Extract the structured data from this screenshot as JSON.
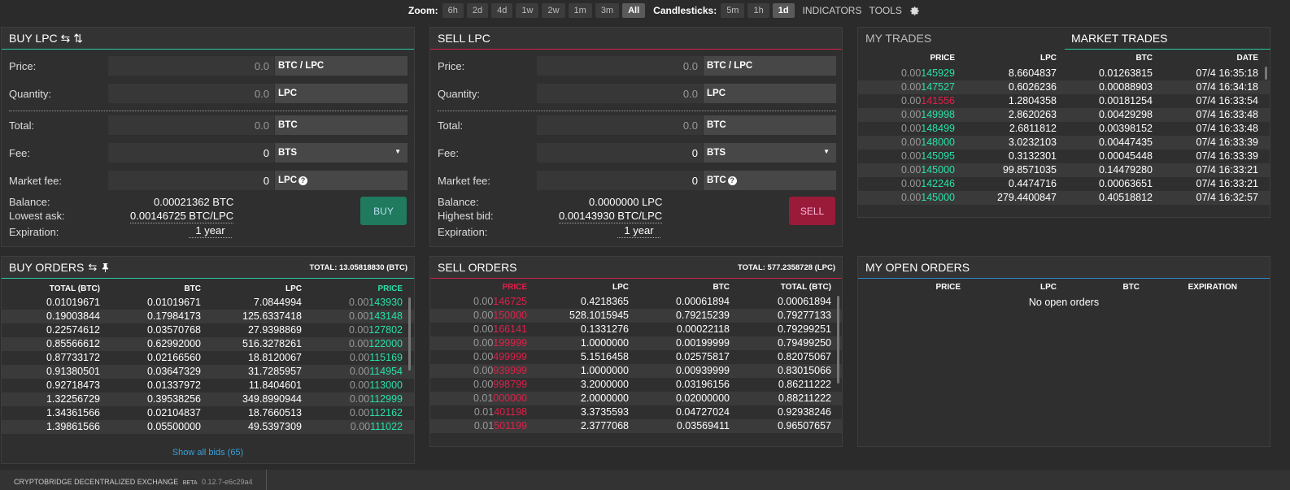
{
  "toolbar": {
    "zoom_label": "Zoom:",
    "zoom": [
      "6h",
      "2d",
      "4d",
      "1w",
      "2w",
      "1m",
      "3m",
      "All"
    ],
    "zoom_active": "All",
    "candle_label": "Candlesticks:",
    "candles": [
      "5m",
      "1h",
      "1d"
    ],
    "candle_active": "1d",
    "indicators": "INDICATORS",
    "tools": "TOOLS"
  },
  "buy": {
    "title": "BUY LPC",
    "title_icons": "⇆ ⇅",
    "price_label": "Price:",
    "price_value": "0.0",
    "price_unit": "BTC / LPC",
    "qty_label": "Quantity:",
    "qty_value": "0.0",
    "qty_unit": "LPC",
    "total_label": "Total:",
    "total_value": "0.0",
    "total_unit": "BTC",
    "fee_label": "Fee:",
    "fee_value": "0",
    "fee_unit": "BTS",
    "mfee_label": "Market fee:",
    "mfee_value": "0",
    "mfee_unit": "LPC",
    "balance_label": "Balance:",
    "balance_value": "0.00021362 BTC",
    "ask_label": "Lowest ask:",
    "ask_value": "0.00146725 BTC/LPC",
    "exp_label": "Expiration:",
    "exp_value": "1 year",
    "button": "BUY"
  },
  "sell": {
    "title": "SELL LPC",
    "price_label": "Price:",
    "price_value": "0.0",
    "price_unit": "BTC / LPC",
    "qty_label": "Quantity:",
    "qty_value": "0.0",
    "qty_unit": "LPC",
    "total_label": "Total:",
    "total_value": "0.0",
    "total_unit": "BTC",
    "fee_label": "Fee:",
    "fee_value": "0",
    "fee_unit": "BTS",
    "mfee_label": "Market fee:",
    "mfee_value": "0",
    "mfee_unit": "BTC",
    "balance_label": "Balance:",
    "balance_value": "0.0000000 LPC",
    "bid_label": "Highest bid:",
    "bid_value": "0.00143930 BTC/LPC",
    "exp_label": "Expiration:",
    "exp_value": "1 year",
    "button": "SELL"
  },
  "trades": {
    "tab_my": "MY TRADES",
    "tab_market": "MARKET TRADES",
    "cols": [
      "PRICE",
      "LPC",
      "BTC",
      "DATE"
    ],
    "rows": [
      {
        "p0": "0.00",
        "p1": "145929",
        "dir": "g",
        "lpc": "8.6604837",
        "btc": "0.01263815",
        "date": "07/4 16:35:18"
      },
      {
        "p0": "0.00",
        "p1": "147527",
        "dir": "g",
        "lpc": "0.6026236",
        "btc": "0.00088903",
        "date": "07/4 16:34:18"
      },
      {
        "p0": "0.00",
        "p1": "141556",
        "dir": "r",
        "lpc": "1.2804358",
        "btc": "0.00181254",
        "date": "07/4 16:33:54"
      },
      {
        "p0": "0.00",
        "p1": "149998",
        "dir": "g",
        "lpc": "2.8620263",
        "btc": "0.00429298",
        "date": "07/4 16:33:48"
      },
      {
        "p0": "0.00",
        "p1": "148499",
        "dir": "g",
        "lpc": "2.6811812",
        "btc": "0.00398152",
        "date": "07/4 16:33:48"
      },
      {
        "p0": "0.00",
        "p1": "148000",
        "dir": "g",
        "lpc": "3.0232103",
        "btc": "0.00447435",
        "date": "07/4 16:33:39"
      },
      {
        "p0": "0.00",
        "p1": "145095",
        "dir": "g",
        "lpc": "0.3132301",
        "btc": "0.00045448",
        "date": "07/4 16:33:39"
      },
      {
        "p0": "0.00",
        "p1": "145000",
        "dir": "g",
        "lpc": "99.8571035",
        "btc": "0.14479280",
        "date": "07/4 16:33:21"
      },
      {
        "p0": "0.00",
        "p1": "142246",
        "dir": "g",
        "lpc": "0.4474716",
        "btc": "0.00063651",
        "date": "07/4 16:33:21"
      },
      {
        "p0": "0.00",
        "p1": "145000",
        "dir": "g",
        "lpc": "279.4400847",
        "btc": "0.40518812",
        "date": "07/4 16:32:57"
      }
    ]
  },
  "buy_orders": {
    "title": "BUY ORDERS",
    "total": "TOTAL: 13.05818830 (BTC)",
    "cols": [
      "TOTAL (BTC)",
      "BTC",
      "LPC",
      "PRICE"
    ],
    "rows": [
      {
        "total": "0.01019671",
        "btc": "0.01019671",
        "lpc": "7.0844994",
        "p0": "0.00",
        "p1": "143930"
      },
      {
        "total": "0.19003844",
        "btc": "0.17984173",
        "lpc": "125.6337418",
        "p0": "0.00",
        "p1": "143148"
      },
      {
        "total": "0.22574612",
        "btc": "0.03570768",
        "lpc": "27.9398869",
        "p0": "0.00",
        "p1": "127802"
      },
      {
        "total": "0.85566612",
        "btc": "0.62992000",
        "lpc": "516.3278261",
        "p0": "0.00",
        "p1": "122000"
      },
      {
        "total": "0.87733172",
        "btc": "0.02166560",
        "lpc": "18.8120067",
        "p0": "0.00",
        "p1": "115169"
      },
      {
        "total": "0.91380501",
        "btc": "0.03647329",
        "lpc": "31.7285957",
        "p0": "0.00",
        "p1": "114954"
      },
      {
        "total": "0.92718473",
        "btc": "0.01337972",
        "lpc": "11.8404601",
        "p0": "0.00",
        "p1": "113000"
      },
      {
        "total": "1.32256729",
        "btc": "0.39538256",
        "lpc": "349.8990944",
        "p0": "0.00",
        "p1": "112999"
      },
      {
        "total": "1.34361566",
        "btc": "0.02104837",
        "lpc": "18.7660513",
        "p0": "0.00",
        "p1": "112162"
      },
      {
        "total": "1.39861566",
        "btc": "0.05500000",
        "lpc": "49.5397309",
        "p0": "0.00",
        "p1": "111022"
      }
    ],
    "show_all": "Show all bids (65)"
  },
  "sell_orders": {
    "title": "SELL ORDERS",
    "total": "TOTAL: 577.2358728 (LPC)",
    "cols": [
      "PRICE",
      "LPC",
      "BTC",
      "TOTAL (BTC)"
    ],
    "rows": [
      {
        "p0": "0.00",
        "p1": "146725",
        "lpc": "0.4218365",
        "btc": "0.00061894",
        "total": "0.00061894"
      },
      {
        "p0": "0.00",
        "p1": "150000",
        "lpc": "528.1015945",
        "btc": "0.79215239",
        "total": "0.79277133"
      },
      {
        "p0": "0.00",
        "p1": "166141",
        "lpc": "0.1331276",
        "btc": "0.00022118",
        "total": "0.79299251"
      },
      {
        "p0": "0.00",
        "p1": "199999",
        "lpc": "1.0000000",
        "btc": "0.00199999",
        "total": "0.79499250"
      },
      {
        "p0": "0.00",
        "p1": "499999",
        "lpc": "5.1516458",
        "btc": "0.02575817",
        "total": "0.82075067"
      },
      {
        "p0": "0.00",
        "p1": "939999",
        "lpc": "1.0000000",
        "btc": "0.00939999",
        "total": "0.83015066"
      },
      {
        "p0": "0.00",
        "p1": "998799",
        "lpc": "3.2000000",
        "btc": "0.03196156",
        "total": "0.86211222"
      },
      {
        "p0": "0.01",
        "p1": "000000",
        "lpc": "2.0000000",
        "btc": "0.02000000",
        "total": "0.88211222"
      },
      {
        "p0": "0.01",
        "p1": "401198",
        "lpc": "3.3735593",
        "btc": "0.04727024",
        "total": "0.92938246"
      },
      {
        "p0": "0.01",
        "p1": "501199",
        "lpc": "2.3777068",
        "btc": "0.03569411",
        "total": "0.96507657"
      }
    ]
  },
  "open_orders": {
    "title": "MY OPEN ORDERS",
    "cols": [
      "PRICE",
      "LPC",
      "BTC",
      "EXPIRATION"
    ],
    "empty": "No open orders"
  },
  "footer": {
    "name": "CRYPTOBRIDGE DECENTRALIZED EXCHANGE",
    "beta": "BETA",
    "version": "0.12.7-e6c29a4"
  }
}
